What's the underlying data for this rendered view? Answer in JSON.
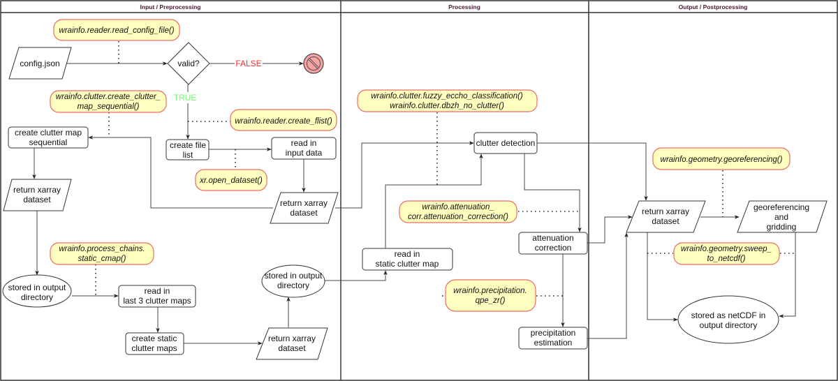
{
  "lanes": [
    {
      "id": "input",
      "title": "Input / Preprocessing"
    },
    {
      "id": "processing",
      "title": "Processing"
    },
    {
      "id": "output",
      "title": "Output / Postprocessing"
    }
  ],
  "nodes": {
    "config_json": {
      "lines": [
        "config.json"
      ]
    },
    "valid": {
      "lines": [
        "valid?"
      ]
    },
    "create_clutter_map": {
      "lines": [
        "create clutter map",
        "sequential"
      ]
    },
    "return_xarray_left": {
      "lines": [
        "return xarray",
        "dataset"
      ]
    },
    "create_file_list": {
      "lines": [
        "create file",
        "list"
      ]
    },
    "read_input_data": {
      "lines": [
        "read in",
        "input data"
      ]
    },
    "return_xarray_mid": {
      "lines": [
        "return xarray",
        "dataset"
      ]
    },
    "stored_output_left": {
      "lines": [
        "stored in output",
        "directory"
      ]
    },
    "read_last3": {
      "lines": [
        "read in",
        "last 3 clutter maps"
      ]
    },
    "create_static": {
      "lines": [
        "create static",
        "clutter maps"
      ]
    },
    "return_xarray_bottom": {
      "lines": [
        "return xarray",
        "dataset"
      ]
    },
    "stored_output_mid": {
      "lines": [
        "stored in output",
        "directory"
      ]
    },
    "read_static": {
      "lines": [
        "read in",
        "static clutter map"
      ]
    },
    "clutter_detection": {
      "lines": [
        "clutter detection"
      ]
    },
    "attenuation_correction": {
      "lines": [
        "attenuation",
        "correction"
      ]
    },
    "precipitation_estimation": {
      "lines": [
        "precipitation",
        "estimation"
      ]
    },
    "return_xarray_right": {
      "lines": [
        "return xarray",
        "dataset"
      ]
    },
    "georeferencing": {
      "lines": [
        "georeferencing",
        "and",
        "gridding"
      ]
    },
    "stored_netcdf": {
      "lines": [
        "stored as netCDF in",
        "output directory"
      ]
    }
  },
  "notes": {
    "read_config_file": {
      "lines": [
        "wrainfo.reader.read_config_file()"
      ]
    },
    "create_clutter_map_sequential": {
      "lines": [
        "wrainfo.clutter.create_clutter_",
        "map_sequential()"
      ]
    },
    "create_flist": {
      "lines": [
        "wrainfo.reader.create_flist()"
      ]
    },
    "open_dataset": {
      "lines": [
        "xr.open_dataset()"
      ]
    },
    "static_cmap": {
      "lines": [
        "wrainfo.process_chains.",
        "static_cmap()"
      ]
    },
    "fuzzy_echo": {
      "lines": [
        "wrainfo.clutter.fuzzy_eccho_classification()",
        "wrainfo.clutter.dbzh_no_clutter()"
      ]
    },
    "attenuation": {
      "lines": [
        "wrainfo.attenuation_",
        "corr.attenuation_correction()"
      ]
    },
    "qpe_zr": {
      "lines": [
        "wrainfo.precipitation.",
        "qpe_zr()"
      ]
    },
    "georeferencing": {
      "lines": [
        "wrainfo.geometry.georeferencing()"
      ]
    },
    "sweep_to_netcdf": {
      "lines": [
        "wrainfo.geometry.sweep_",
        "to_netcdf()"
      ]
    }
  },
  "edge_labels": {
    "false": "FALSE",
    "true": "TRUE"
  },
  "icons": {
    "stop": "prohibited-icon"
  },
  "colors": {
    "note_fill": "#ffffc0",
    "note_stroke": "#ea6b66",
    "false_label": "#ff2a2a",
    "true_label": "#66ff66",
    "lane_title": "#4a1530",
    "stop_fill": "#f8a3a3"
  }
}
